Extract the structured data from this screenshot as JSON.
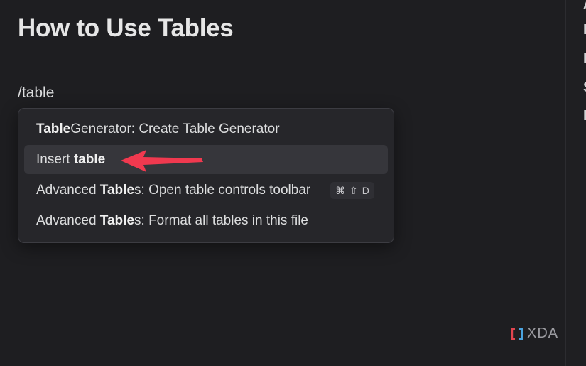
{
  "note": {
    "title": "How to Use Tables",
    "command_text": "/table"
  },
  "suggestions": [
    {
      "bold": "Table",
      "rest": " Generator: Create Table Generator",
      "selected": false
    },
    {
      "pre": "Insert ",
      "bold": "table",
      "selected": true
    },
    {
      "pre": "Advanced ",
      "bold": "Table",
      "rest": "s: Open table controls toolbar",
      "selected": false,
      "hotkey": {
        "cmd": "⌘",
        "shift": "⇧",
        "key": "D"
      }
    },
    {
      "pre": "Advanced ",
      "bold": "Table",
      "rest": "s: Format all tables in this file",
      "selected": false
    }
  ],
  "right_panel": {
    "edge_letters": [
      "A",
      "I",
      "I",
      "S",
      "I"
    ]
  },
  "watermark": {
    "text": "XDA"
  },
  "colors": {
    "arrow": "#f0394f",
    "popup_bg": "#26262a",
    "selected_bg": "#36363b",
    "editor_bg": "#1e1e21"
  }
}
